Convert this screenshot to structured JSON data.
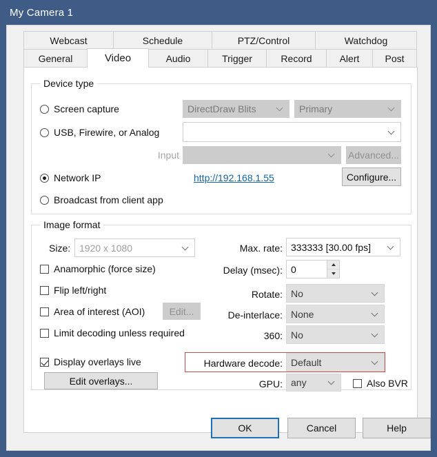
{
  "window": {
    "title": "My Camera 1"
  },
  "tabs": {
    "row1": [
      {
        "label": "Webcast",
        "active": false
      },
      {
        "label": "Schedule",
        "active": false
      },
      {
        "label": "PTZ/Control",
        "active": false
      },
      {
        "label": "Watchdog",
        "active": false
      }
    ],
    "row2": [
      {
        "label": "General",
        "active": false
      },
      {
        "label": "Video",
        "active": true
      },
      {
        "label": "Audio",
        "active": false
      },
      {
        "label": "Trigger",
        "active": false
      },
      {
        "label": "Record",
        "active": false
      },
      {
        "label": "Alert",
        "active": false
      },
      {
        "label": "Post",
        "active": false
      }
    ]
  },
  "device_type": {
    "legend": "Device type",
    "options": [
      {
        "label": "Screen capture",
        "selected": false
      },
      {
        "label": "USB, Firewire, or Analog",
        "selected": false
      },
      {
        "label": "Network IP",
        "selected": true
      },
      {
        "label": "Broadcast from client app",
        "selected": false
      }
    ],
    "screen_capture_method": "DirectDraw Blits",
    "screen_capture_monitor": "Primary",
    "usb_device": "",
    "input_label": "Input",
    "input_value": "",
    "advanced_button": "Advanced...",
    "network_url": "http://192.168.1.55",
    "configure_button": "Configure..."
  },
  "image_format": {
    "legend": "Image format",
    "size_label": "Size:",
    "size_value": "1920 x 1080",
    "checkboxes": [
      {
        "label": "Anamorphic (force size)",
        "checked": false
      },
      {
        "label": "Flip left/right",
        "checked": false
      },
      {
        "label": "Area of interest (AOI)",
        "checked": false
      },
      {
        "label": "Limit decoding unless required",
        "checked": false
      },
      {
        "label": "Display overlays live",
        "checked": true
      }
    ],
    "aoi_edit_button": "Edit...",
    "edit_overlays_button": "Edit overlays...",
    "max_rate_label": "Max. rate:",
    "max_rate_value": "333333 [30.00 fps]",
    "delay_label": "Delay (msec):",
    "delay_value": "0",
    "rotate_label": "Rotate:",
    "rotate_value": "No",
    "deinterlace_label": "De-interlace:",
    "deinterlace_value": "None",
    "threesixty_label": "360:",
    "threesixty_value": "No",
    "hardware_decode_label": "Hardware decode:",
    "hardware_decode_value": "Default",
    "gpu_label": "GPU:",
    "gpu_value": "any",
    "also_bvr": {
      "label": "Also BVR",
      "checked": false
    }
  },
  "footer": {
    "ok": "OK",
    "cancel": "Cancel",
    "help": "Help"
  },
  "colors": {
    "titlebar": "#3f5c87",
    "accent_link": "#1464a0",
    "highlight_border": "#c0504d",
    "default_button_border": "#1d6fb8"
  }
}
